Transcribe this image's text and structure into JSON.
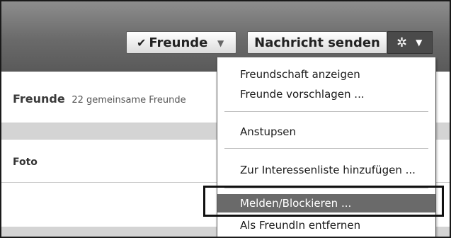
{
  "header": {
    "friends_button": {
      "check": "✔",
      "label": "Freunde",
      "caret": "▼"
    },
    "message_button": {
      "label": "Nachricht senden"
    },
    "gear_button": {
      "gear": "✲",
      "caret": "▼"
    }
  },
  "content": {
    "friends_title": "Freunde",
    "mutual_friends": "22 gemeinsame Freunde",
    "foto_label": "Foto"
  },
  "dropdown": {
    "items": [
      "Freundschaft anzeigen",
      "Freunde vorschlagen ...",
      "Anstupsen",
      "Zur Interessenliste hinzufügen ...",
      "Melden/Blockieren ...",
      "Als FreundIn entfernen"
    ]
  },
  "colors": {
    "header_gradient_top": "#8d8d8d",
    "header_gradient_bottom": "#5a5a5a",
    "selected_item_bg": "#6a6a6a"
  }
}
